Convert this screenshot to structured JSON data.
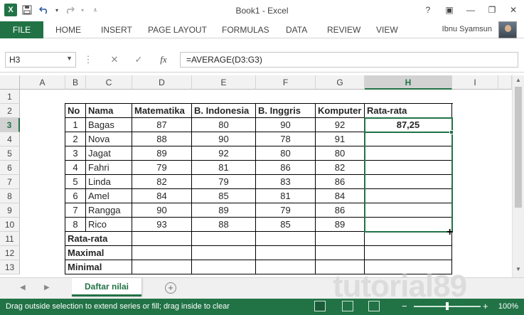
{
  "window": {
    "title": "Book1 - Excel",
    "logo_letter": "X"
  },
  "qat": {
    "save_icon": "save-icon",
    "undo_icon": "undo-icon",
    "redo_icon": "redo-icon"
  },
  "ribbon": {
    "tabs": [
      "FILE",
      "HOME",
      "INSERT",
      "PAGE LAYOUT",
      "FORMULAS",
      "DATA",
      "REVIEW",
      "VIEW"
    ],
    "user": "Ibnu Syamsun"
  },
  "formula_bar": {
    "name_box": "H3",
    "formula": "=AVERAGE(D3:G3)",
    "fx": "fx"
  },
  "columns": [
    "A",
    "B",
    "C",
    "D",
    "E",
    "F",
    "G",
    "H",
    "I"
  ],
  "rows": [
    "1",
    "2",
    "3",
    "4",
    "5",
    "6",
    "7",
    "8",
    "9",
    "10",
    "11",
    "12",
    "13"
  ],
  "table": {
    "headers": [
      "No",
      "Nama",
      "Matematika",
      "B. Indonesia",
      "B. Inggris",
      "Komputer",
      "Rata-rata"
    ],
    "data": [
      [
        "1",
        "Bagas",
        "87",
        "80",
        "90",
        "92",
        "87,25"
      ],
      [
        "2",
        "Nova",
        "88",
        "90",
        "78",
        "91",
        ""
      ],
      [
        "3",
        "Jagat",
        "89",
        "92",
        "80",
        "80",
        ""
      ],
      [
        "4",
        "Fahri",
        "79",
        "81",
        "86",
        "82",
        ""
      ],
      [
        "5",
        "Linda",
        "82",
        "79",
        "83",
        "86",
        ""
      ],
      [
        "6",
        "Amel",
        "84",
        "85",
        "81",
        "84",
        ""
      ],
      [
        "7",
        "Rangga",
        "90",
        "89",
        "79",
        "86",
        ""
      ],
      [
        "8",
        "Rico",
        "93",
        "88",
        "85",
        "89",
        ""
      ]
    ],
    "summary_labels": [
      "Rata-rata",
      "Maximal",
      "Minimal"
    ]
  },
  "sheet": {
    "tab": "Daftar nilai"
  },
  "status": {
    "message": "Drag outside selection to extend series or fill; drag inside to clear",
    "zoom": "100%"
  },
  "watermark": "tutorial89",
  "colors": {
    "accent": "#217346"
  }
}
